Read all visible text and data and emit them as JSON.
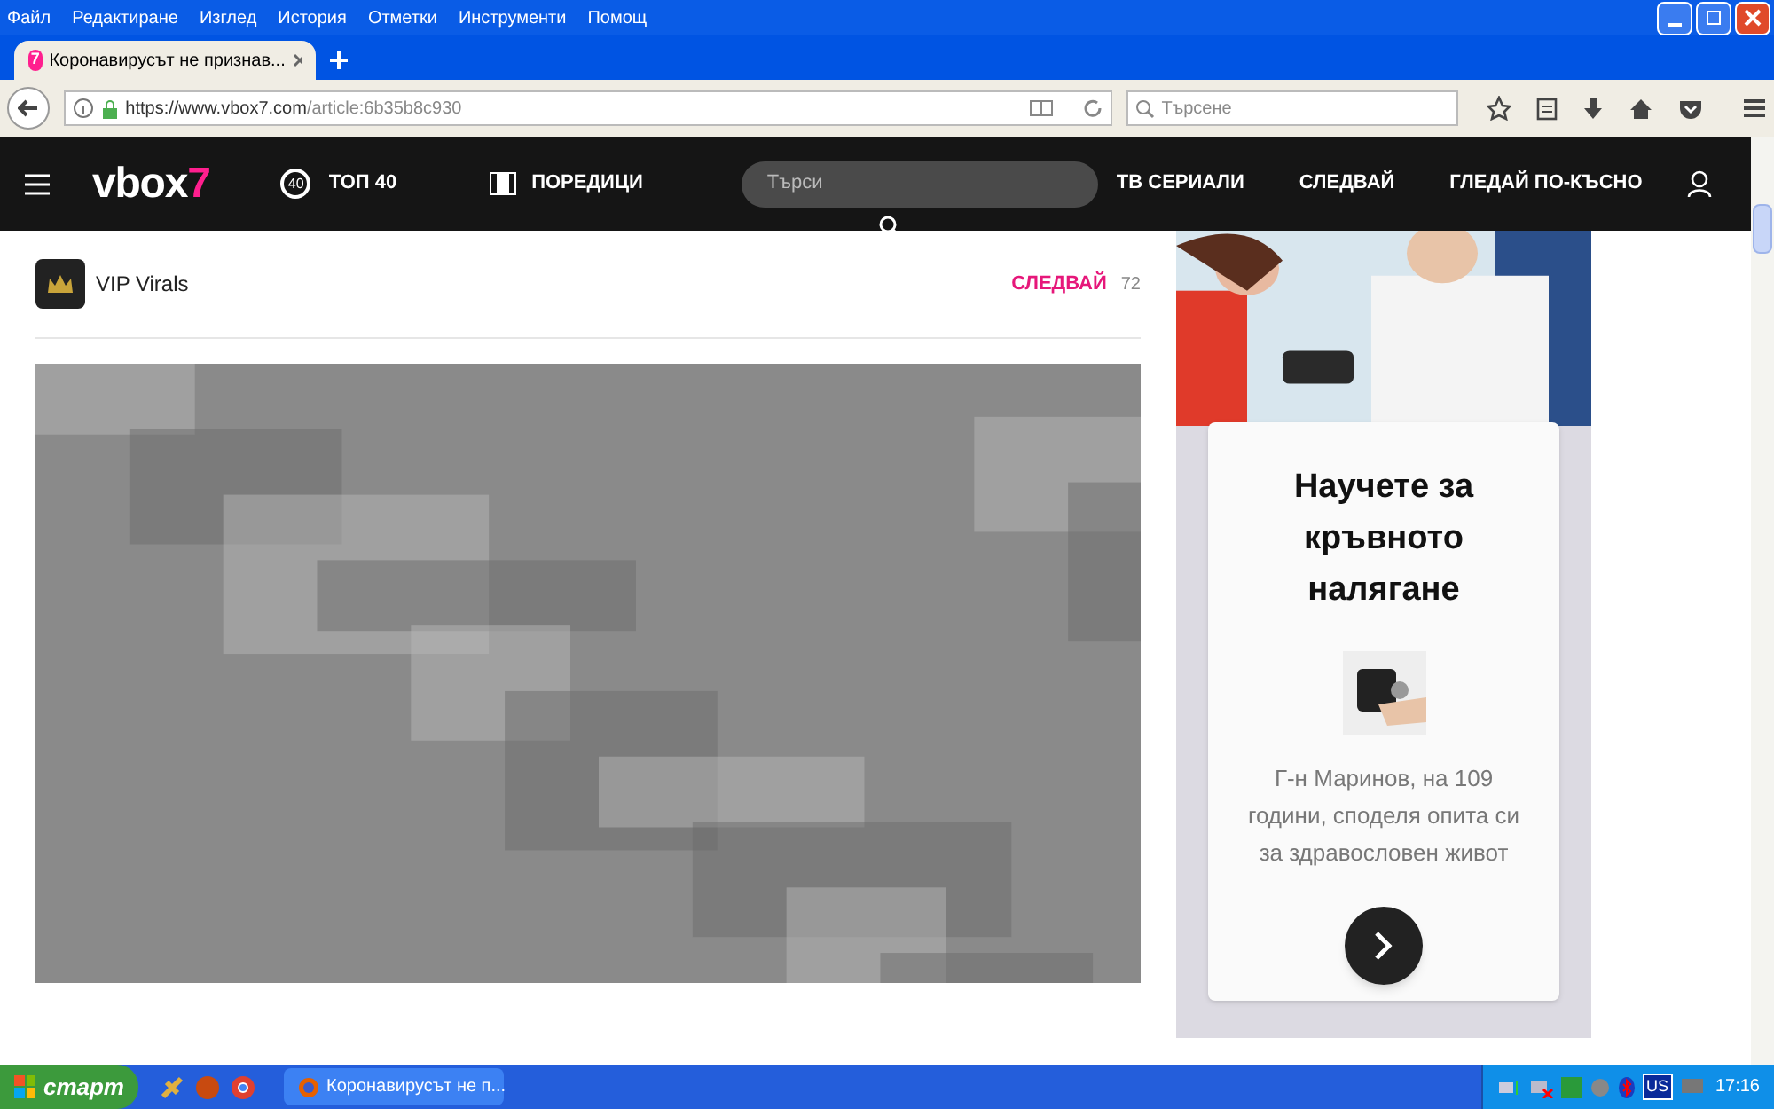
{
  "menu_bar": [
    "Файл",
    "Редактиране",
    "Изглед",
    "История",
    "Отметки",
    "Инструменти",
    "Помощ"
  ],
  "tabs": [
    {
      "title": "Коронавирусът не признав...",
      "favicon": "7",
      "selected": true
    }
  ],
  "address_bar": {
    "url_host": "https://www.vbox7.com",
    "url_path": "/article:6b35b8c930"
  },
  "browser_search": {
    "placeholder": "Търсене"
  },
  "site_header": {
    "logo_main": "vbox",
    "logo_accent": "7",
    "top_badge": "40",
    "nav": [
      "ТОП 40",
      "ПОРЕДИЦИ"
    ],
    "search": {
      "placeholder": "Търси"
    },
    "nav_right": [
      "ТВ СЕРИАЛИ",
      "СЛЕДВАЙ",
      "ГЛЕДАЙ ПО-КЪСНО"
    ]
  },
  "channel": {
    "name": "VIP Virals",
    "follow": "СЛЕДВАЙ",
    "followers": "72"
  },
  "ad": {
    "title": "Научете за кръвното налягане",
    "text": "Г-н Маринов, на 109 години, споделя опита си за здравословен живот"
  },
  "taskbar": {
    "start": "старт",
    "windows": [
      {
        "title": "Коронавирусът не п...",
        "selected": false
      }
    ],
    "lang": "US",
    "clock": "17:16"
  }
}
